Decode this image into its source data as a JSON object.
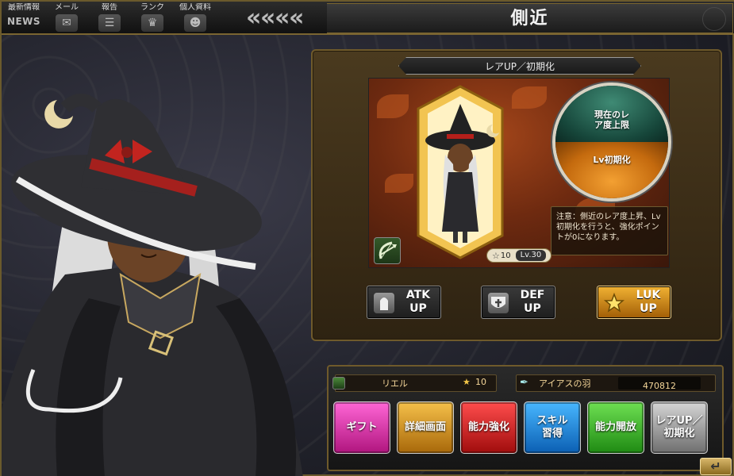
{
  "topbar": {
    "menu": [
      {
        "label": "最新情報",
        "extra": "NEWS"
      },
      {
        "label": "メール",
        "icon": "mail-icon"
      },
      {
        "label": "報告",
        "icon": "report-icon"
      },
      {
        "label": "ランク",
        "icon": "crown-icon"
      },
      {
        "label": "個人資料",
        "icon": "profile-icon"
      }
    ],
    "title": "側近"
  },
  "panel": {
    "tab_label": "レアUP／初期化",
    "orb": {
      "upper": "現在のレ\nア度上限",
      "lower": "Lv初期化"
    },
    "note": "注意：側近のレア度上昇、Lv初期化を行うと、強化ポイントが0になります。",
    "card": {
      "stars": "10",
      "level": "Lv.30"
    },
    "buttons": [
      {
        "label": "ATK\nUP",
        "icon": "atk-icon"
      },
      {
        "label": "DEF\nUP",
        "icon": "def-shield-icon"
      },
      {
        "label": "LUK\nUP",
        "icon": "luk-star-icon"
      }
    ]
  },
  "dock": {
    "character_name": "リエル",
    "rank": "10",
    "item_name": "アイアスの羽",
    "item_count": "470812",
    "buttons": [
      {
        "label": "ギフト",
        "color": "#e03aa8"
      },
      {
        "label": "詳細画面",
        "color": "#d8951c"
      },
      {
        "label": "能力強化",
        "color": "#d62020"
      },
      {
        "label": "スキル\n習得",
        "color": "#1d86dc"
      },
      {
        "label": "能力開放",
        "color": "#3fb52a"
      },
      {
        "label": "レアUP／\n初期化",
        "color": "#9a9a9a"
      }
    ],
    "back_label": "↵"
  },
  "colors": {
    "frame_gold": "#7a6531",
    "panel_brown": "#3a2c16",
    "orb_green": "#16463a",
    "orb_orange": "#c46a0e"
  }
}
